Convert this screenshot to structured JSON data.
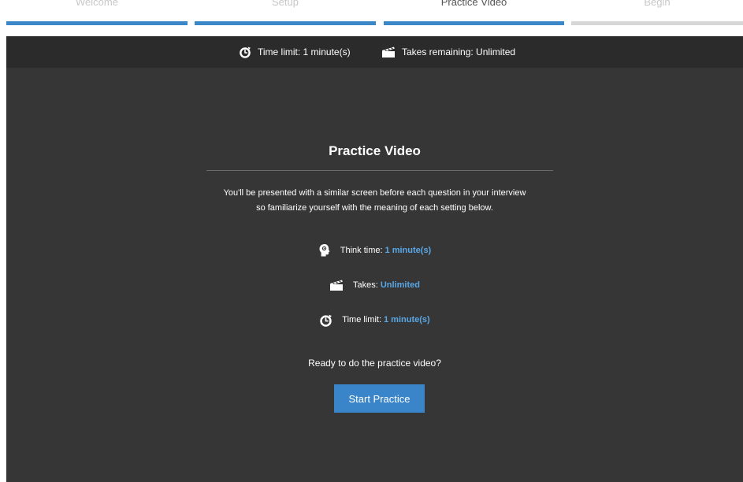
{
  "steps": [
    {
      "label": "Welcome",
      "state": "done"
    },
    {
      "label": "Setup",
      "state": "done"
    },
    {
      "label": "Practice Video",
      "state": "current"
    },
    {
      "label": "Begin",
      "state": "pending"
    }
  ],
  "info_bar": {
    "time_limit": "Time limit: 1 minute(s)",
    "takes_remaining": "Takes remaining: Unlimited"
  },
  "main": {
    "title": "Practice Video",
    "intro_line1": "You'll be presented with a similar screen before each question in your interview",
    "intro_line2": "so familiarize yourself with the meaning of each setting below.",
    "settings": [
      {
        "label": "Think time:",
        "value": "1 minute(s)",
        "icon": "think-head-icon"
      },
      {
        "label": "Takes:",
        "value": "Unlimited",
        "icon": "clapperboard-icon"
      },
      {
        "label": "Time limit:",
        "value": "1 minute(s)",
        "icon": "timer-icon"
      }
    ],
    "prompt": "Ready to do the practice video?",
    "start_label": "Start Practice"
  },
  "colors": {
    "accent": "#3a85c9",
    "value_text": "#5aa7e6",
    "panel_bg": "#363636",
    "info_bar_bg": "#2b2b2b",
    "pending_step": "#d7d7d7"
  }
}
